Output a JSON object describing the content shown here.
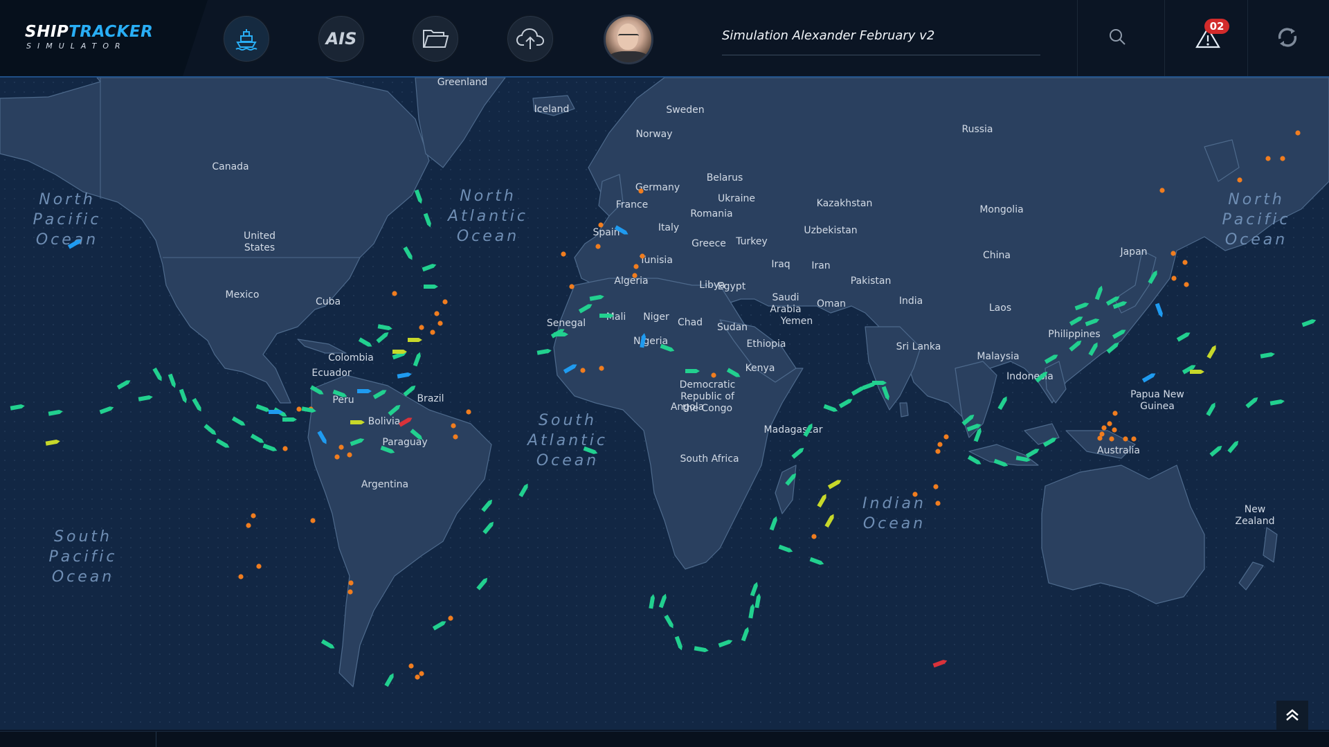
{
  "app": {
    "logo_line1_a": "SHIP",
    "logo_line1_b": "TRACKER",
    "logo_line2": "SIMULATOR"
  },
  "nav": {
    "ais_label": "AIS",
    "items": [
      "ship-icon",
      "ais-icon",
      "folder-icon",
      "cloud-upload-icon",
      "user-avatar"
    ]
  },
  "header": {
    "simulation_title": "Simulation Alexander February v2",
    "alerts_count": "02",
    "icons": [
      "search-icon",
      "warning-icon",
      "sync-icon"
    ]
  },
  "colors": {
    "accent": "#29aef5",
    "ship_green": "#22d08f",
    "ship_blue": "#1f9bf0",
    "ship_yellow": "#c7d82a",
    "ship_red": "#d9323a",
    "port_orange": "#f07d1f",
    "badge_red": "#d22b2b"
  },
  "map": {
    "countries": [
      "Greenland",
      "Iceland",
      "Sweden",
      "Norway",
      "Russia",
      "Canada",
      "Germany",
      "Belarus",
      "France",
      "Ukraine",
      "Kazakhstan",
      "Mongolia",
      "Romania",
      "Italy",
      "Spain",
      "Greece",
      "Turkey",
      "Uzbekistan",
      "United States",
      "Japan",
      "China",
      "Tunisia",
      "Iraq",
      "Iran",
      "Algeria",
      "Libya",
      "Egypt",
      "Saudi Arabia",
      "Pakistan",
      "Mexico",
      "Cuba",
      "India",
      "Oman",
      "Laos",
      "Mali",
      "Niger",
      "Chad",
      "Sudan",
      "Yemen",
      "Senegal",
      "Philippines",
      "Nigeria",
      "Ethiopia",
      "Sri Lanka",
      "Colombia",
      "Malaysia",
      "Democratic Republic of the Congo",
      "Kenya",
      "Ecuador",
      "Indonesia",
      "Papua New Guinea",
      "Peru",
      "Brazil",
      "Angola",
      "Bolivia",
      "Madagascar",
      "Paraguay",
      "South Africa",
      "Australia",
      "Argentina",
      "New Zealand"
    ],
    "oceans": [
      "North Pacific Ocean",
      "North Pacific Ocean",
      "North Atlantic Ocean",
      "South Atlantic Ocean",
      "Indian Ocean",
      "South Pacific Ocean"
    ]
  },
  "vessels": {
    "green_count": 108,
    "blue_count": 10,
    "yellow_count": 10,
    "red_count": 2,
    "orange_ports": 62
  }
}
